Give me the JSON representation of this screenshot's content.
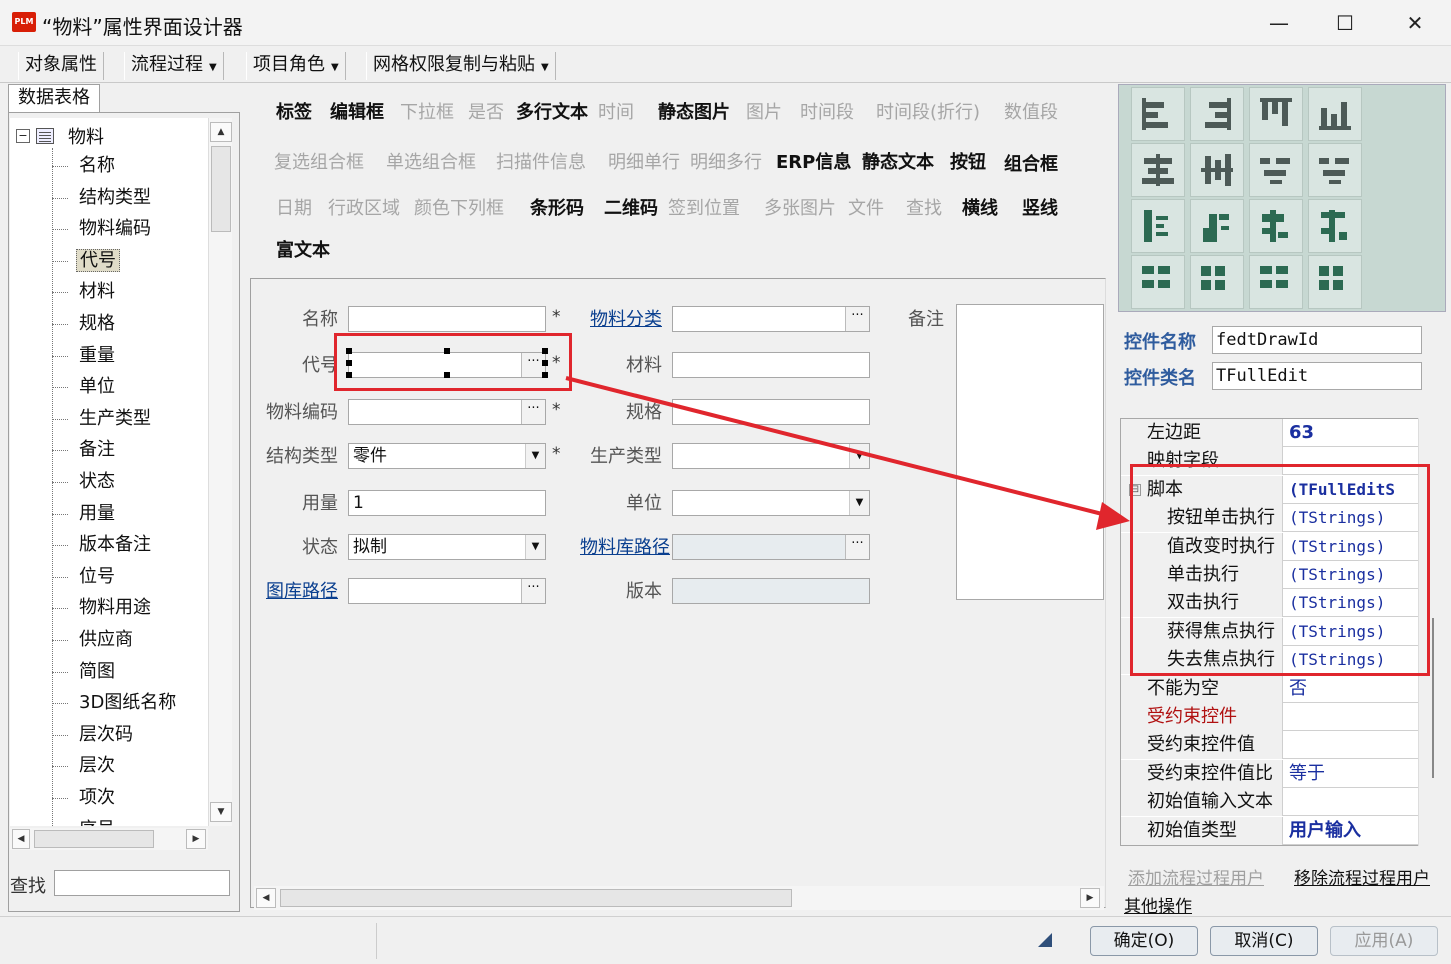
{
  "window": {
    "app_badge": "PLM",
    "title": "“物料”属性界面设计器",
    "min": "—",
    "max": "☐",
    "close": "✕"
  },
  "toolbar": {
    "items": [
      {
        "label": "对象属性",
        "dropdown": false
      },
      {
        "label": "流程过程",
        "dropdown": true
      },
      {
        "label": "项目角色",
        "dropdown": true
      },
      {
        "label": "网格权限复制与粘贴",
        "dropdown": true
      }
    ]
  },
  "left_panel": {
    "tab": "数据表格",
    "tree_root": "物料",
    "tree_items": [
      "名称",
      "结构类型",
      "物料编码",
      "代号",
      "材料",
      "规格",
      "重量",
      "单位",
      "生产类型",
      "备注",
      "状态",
      "用量",
      "版本备注",
      "位号",
      "物料用途",
      "供应商",
      "简图",
      "3D图纸名称",
      "层次码",
      "层次",
      "项次",
      "序号"
    ],
    "selected_index": 3,
    "search_label": "查找",
    "search_value": ""
  },
  "controls": [
    {
      "label": "标签",
      "enabled": true
    },
    {
      "label": "编辑框",
      "enabled": true
    },
    {
      "label": "下拉框",
      "enabled": false
    },
    {
      "label": "是否",
      "enabled": false
    },
    {
      "label": "多行文本",
      "enabled": true
    },
    {
      "label": "时间",
      "enabled": false
    },
    {
      "label": "静态图片",
      "enabled": true
    },
    {
      "label": "图片",
      "enabled": false
    },
    {
      "label": "时间段",
      "enabled": false
    },
    {
      "label": "时间段(折行)",
      "enabled": false
    },
    {
      "label": "数值段",
      "enabled": false
    },
    {
      "label": "复选组合框",
      "enabled": false
    },
    {
      "label": "单选组合框",
      "enabled": false
    },
    {
      "label": "扫描件信息",
      "enabled": false
    },
    {
      "label": "明细单行",
      "enabled": false
    },
    {
      "label": "明细多行",
      "enabled": false
    },
    {
      "label": "ERP信息",
      "enabled": true
    },
    {
      "label": "静态文本",
      "enabled": true
    },
    {
      "label": "按钮",
      "enabled": true
    },
    {
      "label": "组合框",
      "enabled": true
    },
    {
      "label": "日期",
      "enabled": false
    },
    {
      "label": "行政区域",
      "enabled": false
    },
    {
      "label": "颜色下列框",
      "enabled": false
    },
    {
      "label": "条形码",
      "enabled": true
    },
    {
      "label": "二维码",
      "enabled": true
    },
    {
      "label": "签到位置",
      "enabled": false
    },
    {
      "label": "多张图片",
      "enabled": false
    },
    {
      "label": "文件",
      "enabled": false
    },
    {
      "label": "查找",
      "enabled": false
    },
    {
      "label": "横线",
      "enabled": true
    },
    {
      "label": "竖线",
      "enabled": true
    },
    {
      "label": "富文本",
      "enabled": true
    }
  ],
  "form": {
    "fields": [
      {
        "label": "名称",
        "value": "",
        "required": true,
        "type": "text",
        "link": false
      },
      {
        "label": "代号",
        "value": "",
        "required": true,
        "type": "browse",
        "link": false
      },
      {
        "label": "物料编码",
        "value": "",
        "required": true,
        "type": "browse",
        "link": false
      },
      {
        "label": "结构类型",
        "value": "零件",
        "required": true,
        "type": "select",
        "link": false
      },
      {
        "label": "用量",
        "value": "1",
        "required": false,
        "type": "text",
        "link": false
      },
      {
        "label": "状态",
        "value": "拟制",
        "required": false,
        "type": "select",
        "link": false
      },
      {
        "label": "图库路径",
        "value": "",
        "required": false,
        "type": "browse",
        "link": true
      },
      {
        "label": "物料分类",
        "value": "",
        "required": false,
        "type": "browse",
        "link": true
      },
      {
        "label": "材料",
        "value": "",
        "required": false,
        "type": "text",
        "link": false
      },
      {
        "label": "规格",
        "value": "",
        "required": false,
        "type": "text",
        "link": false
      },
      {
        "label": "生产类型",
        "value": "",
        "required": false,
        "type": "select",
        "link": false
      },
      {
        "label": "单位",
        "value": "",
        "required": false,
        "type": "select",
        "link": false
      },
      {
        "label": "物料库路径",
        "value": "",
        "required": false,
        "type": "browse-disabled",
        "link": true
      },
      {
        "label": "版本",
        "value": "",
        "required": false,
        "type": "disabled",
        "link": false
      }
    ],
    "memo_label": "备注",
    "star": "*",
    "browse_glyph": "···",
    "dropdown_glyph": "▼"
  },
  "properties": {
    "control_name_label": "控件名称",
    "control_name": "fedtDrawId",
    "control_class_label": "控件类名",
    "control_class": "TFullEdit",
    "rows": [
      {
        "name": "左边距",
        "value": "63",
        "level": 0,
        "style": "bold"
      },
      {
        "name": "映射字段",
        "value": "",
        "level": 0,
        "style": ""
      },
      {
        "name": "脚本",
        "value": "(TFullEditS",
        "level": 0,
        "style": "bold-mono",
        "expand": "⊟"
      },
      {
        "name": "按钮单击执行",
        "value": "(TStrings)",
        "level": 1,
        "style": "mono"
      },
      {
        "name": "值改变时执行",
        "value": "(TStrings)",
        "level": 1,
        "style": "mono"
      },
      {
        "name": "单击执行",
        "value": "(TStrings)",
        "level": 1,
        "style": "mono"
      },
      {
        "name": "双击执行",
        "value": "(TStrings)",
        "level": 1,
        "style": "mono"
      },
      {
        "name": "获得焦点执行",
        "value": "(TStrings)",
        "level": 1,
        "style": "mono"
      },
      {
        "name": "失去焦点执行",
        "value": "(TStrings)",
        "level": 1,
        "style": "mono"
      },
      {
        "name": "不能为空",
        "value": "否",
        "level": 0,
        "style": ""
      },
      {
        "name": "受约束控件",
        "value": "",
        "level": 0,
        "style": "",
        "red": true
      },
      {
        "name": "受约束控件值",
        "value": "",
        "level": 0,
        "style": ""
      },
      {
        "name": "受约束控件值比",
        "value": "等于",
        "level": 0,
        "style": ""
      },
      {
        "name": "初始值输入文本",
        "value": "",
        "level": 0,
        "style": ""
      },
      {
        "name": "初始值类型",
        "value": "用户输入",
        "level": 0,
        "style": "bold"
      }
    ],
    "link_add": "添加流程过程用户",
    "link_remove": "移除流程过程用户",
    "link_other": "其他操作"
  },
  "footer": {
    "ok": "确定(O)",
    "cancel": "取消(C)",
    "apply": "应用(A)"
  },
  "colors": {
    "annotation_red": "#e0262d",
    "link_blue": "#0a3f8f",
    "prop_label": "#2f5c9e"
  }
}
